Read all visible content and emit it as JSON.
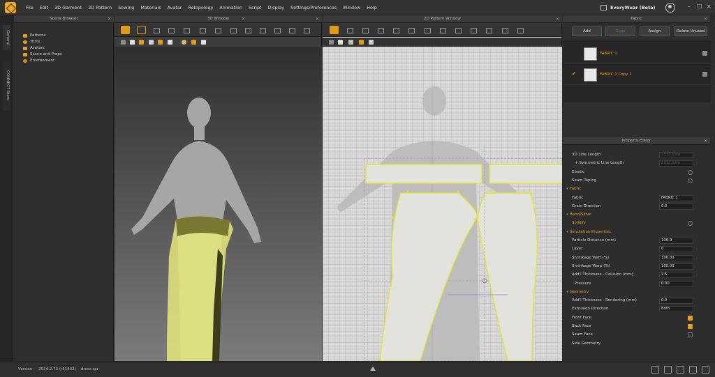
{
  "menu": [
    "File",
    "Edit",
    "3D Garment",
    "2D Pattern",
    "Sewing",
    "Materials",
    "Avatar",
    "Retopology",
    "Animation",
    "Script",
    "Display",
    "Settings/Preferences",
    "Window",
    "Help"
  ],
  "app_brand": "EveryWear (Beta)",
  "left_tabs": [
    "General",
    "CONNECT Store"
  ],
  "scene_browser": {
    "title": "Scene Browser",
    "items": [
      {
        "label": "Patterns",
        "color": "#e7a01a"
      },
      {
        "label": "Trims",
        "color": "#e7a01a"
      },
      {
        "label": "Avatars",
        "color": "#e7a01a"
      },
      {
        "label": "Scene and Props",
        "color": "#e7a01a"
      },
      {
        "label": "Environment",
        "color": "#e7a01a"
      }
    ]
  },
  "window3d": {
    "title": "3D Window"
  },
  "window2d": {
    "title": "2D Pattern Window"
  },
  "fabric": {
    "title": "Fabric",
    "buttons": {
      "add": "Add",
      "copy": "Copy",
      "assign": "Assign",
      "delete": "Delete Unused"
    },
    "items": [
      {
        "name": "FABRIC 1",
        "checked": ""
      },
      {
        "name": "FABRIC 1 Copy 1",
        "checked": "✔"
      }
    ]
  },
  "property_editor": {
    "title": "Property Editor",
    "rows": [
      {
        "label": "3D Line Length",
        "value": "2312.12m",
        "disabled": true
      },
      {
        "label": "+ Symmetric Line Length",
        "value": "2312.12m",
        "disabled": true
      },
      {
        "label": "Elastic",
        "check": false
      },
      {
        "label": "Seam Taping",
        "check": false
      },
      {
        "label": "Fabric",
        "section": true
      },
      {
        "label": "Fabric",
        "value": "FABRIC 1"
      },
      {
        "label": "Grain Direction",
        "value": "0.0"
      },
      {
        "label": "Bond/Skive",
        "section": true
      },
      {
        "label": "Solidify",
        "check": false,
        "orange": true
      },
      {
        "label": "Simulation Properties",
        "section": true
      },
      {
        "label": "Particle Distance (mm)",
        "value": "100.0"
      },
      {
        "label": "Layer",
        "value": "0"
      },
      {
        "label": "Shrinkage Weft (%)",
        "value": "100.00"
      },
      {
        "label": "Shrinkage Warp (%)",
        "value": "100.00"
      },
      {
        "label": "Add'l Thickness - Collision (mm)",
        "value": "2.5"
      },
      {
        "label": "Pressure",
        "value": "0.00"
      },
      {
        "label": "Geometry",
        "section": true
      },
      {
        "label": "Add'l Thickness - Rendering (mm)",
        "value": "0.0"
      },
      {
        "label": "Extrusion Direction",
        "value": "Both"
      },
      {
        "label": "Front Face",
        "check": true
      },
      {
        "label": "Back Face",
        "check": true
      },
      {
        "label": "Seam Face",
        "check": false
      },
      {
        "label": "Side Geometry",
        "section": false
      }
    ]
  },
  "status": {
    "version_label": "Version:",
    "version": "2024.2.73 (r51432)",
    "file": "dress.zpr"
  },
  "colors": {
    "accent": "#e7a01a",
    "garment": "#e6e67a"
  }
}
